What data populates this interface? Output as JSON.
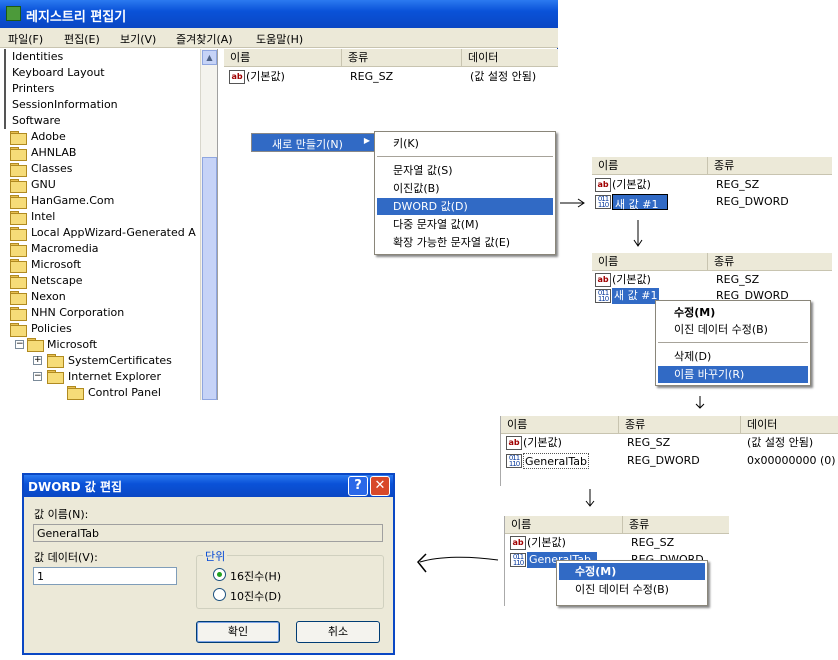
{
  "window": {
    "title": "레지스트리 편집기"
  },
  "menubar": [
    "파일(F)",
    "편집(E)",
    "보기(V)",
    "즐겨찾기(A)",
    "도움말(H)"
  ],
  "tree": {
    "top_items": [
      "Identities",
      "Keyboard Layout",
      "Printers",
      "SessionInformation",
      "Software"
    ],
    "folders": [
      "Adobe",
      "AHNLAB",
      "Classes",
      "GNU",
      "HanGame.Com",
      "Intel",
      "Local AppWizard-Generated A",
      "Macromedia",
      "Microsoft",
      "Netscape",
      "Nexon",
      "NHN Corporation",
      "Policies"
    ],
    "sub_microsoft": "Microsoft",
    "sub_syscert": "SystemCertificates",
    "sub_ie": "Internet Explorer",
    "sub_cp": "Control Panel"
  },
  "list": {
    "col_name": "이름",
    "col_type": "종류",
    "col_data": "데이터",
    "default_name": "(기본값)",
    "default_type": "REG_SZ",
    "default_data": "(값 설정 안됨)"
  },
  "context_new": {
    "parent": "새로 만들기(N)",
    "items": [
      "키(K)",
      "문자열 값(S)",
      "이진값(B)",
      "DWORD 값(D)",
      "다중 문자열 값(M)",
      "확장 가능한 문자열 값(E)"
    ]
  },
  "step1": {
    "h_name": "이름",
    "h_type": "종류",
    "r1_name": "(기본값)",
    "r1_type": "REG_SZ",
    "r2_name": "새 값 #1",
    "r2_type": "REG_DWORD"
  },
  "step2": {
    "h_name": "이름",
    "h_type": "종류",
    "r1_name": "(기본값)",
    "r1_type": "REG_SZ",
    "r2_name": "새 값 #1",
    "r2_type": "REG_DWORD",
    "menu": [
      "수정(M)",
      "이진 데이터 수정(B)",
      "삭제(D)",
      "이름 바꾸기(R)"
    ]
  },
  "step3": {
    "h_name": "이름",
    "h_type": "종류",
    "h_data": "데이터",
    "r1_name": "(기본값)",
    "r1_type": "REG_SZ",
    "r1_data": "(값 설정 안됨)",
    "r2_name": "GeneralTab",
    "r2_type": "REG_DWORD",
    "r2_data": "0x00000000 (0)"
  },
  "step4": {
    "h_name": "이름",
    "h_type": "종류",
    "r1_name": "(기본값)",
    "r1_type": "REG_SZ",
    "r2_name": "GeneralTab",
    "r2_type": "REG_DWORD",
    "menu": [
      "수정(M)",
      "이진 데이터 수정(B)"
    ]
  },
  "dialog": {
    "title": "DWORD 값 편집",
    "name_label": "값 이름(N):",
    "name_value": "GeneralTab",
    "data_label": "값 데이터(V):",
    "data_value": "1",
    "base_label": "단위",
    "hex_label": "16진수(H)",
    "dec_label": "10진수(D)",
    "ok": "확인",
    "cancel": "취소",
    "help": "?"
  },
  "colors": {
    "titlebar": "#0a52d8",
    "selection": "#316ac5",
    "face": "#ece9d8"
  }
}
